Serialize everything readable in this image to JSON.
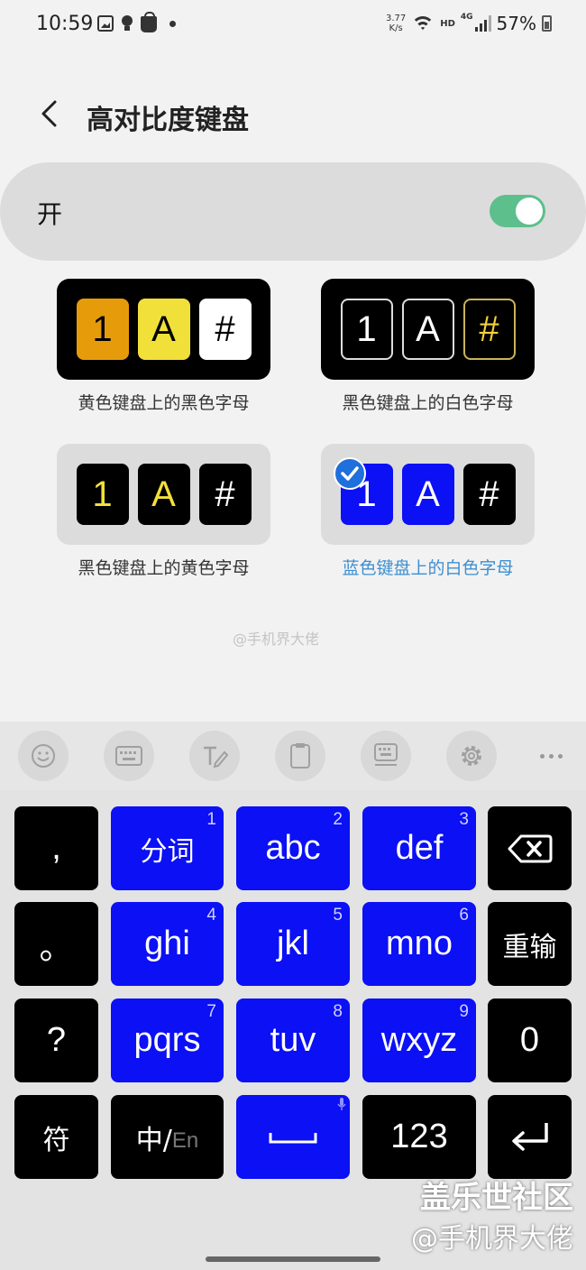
{
  "status_bar": {
    "time": "10:59",
    "net_speed_value": "3.77",
    "net_speed_unit": "K/s",
    "hd": "HD",
    "network": "4G",
    "battery": "57%"
  },
  "header": {
    "title": "高对比度键盘"
  },
  "toggle": {
    "label": "开",
    "state": "on",
    "color": "#5dbf8c"
  },
  "themes": [
    {
      "caption": "黄色键盘上的黑色字母",
      "keys": [
        "1",
        "A",
        "#"
      ],
      "selected": false
    },
    {
      "caption": "黑色键盘上的白色字母",
      "keys": [
        "1",
        "A",
        "#"
      ],
      "selected": false
    },
    {
      "caption": "黑色键盘上的黄色字母",
      "keys": [
        "1",
        "A",
        "#"
      ],
      "selected": false
    },
    {
      "caption": "蓝色键盘上的白色字母",
      "keys": [
        "1",
        "A",
        "#"
      ],
      "selected": true
    }
  ],
  "watermark_mid": "@手机界大佬",
  "toolbar_icons": [
    "emoji-icon",
    "keyboard-icon",
    "handwriting-icon",
    "clipboard-icon",
    "keyboard-mode-icon",
    "gear-icon",
    "more-icon"
  ],
  "keyboard": {
    "row1": {
      "left": ",",
      "k1": "分词",
      "n1": "1",
      "k2": "abc",
      "n2": "2",
      "k3": "def",
      "n3": "3"
    },
    "row2": {
      "left": "。",
      "k1": "ghi",
      "n1": "4",
      "k2": "jkl",
      "n2": "5",
      "k3": "mno",
      "n3": "6",
      "right": "重输"
    },
    "row3": {
      "left": "?",
      "k1": "pqrs",
      "n1": "7",
      "k2": "tuv",
      "n2": "8",
      "k3": "wxyz",
      "n3": "9",
      "right": "0"
    },
    "row4": {
      "left": "符",
      "lang_cn": "中/",
      "lang_en": "En",
      "num": "123"
    },
    "colors": {
      "blue": "#0b10f5",
      "black": "#000000"
    }
  },
  "watermark_br_1": "盖乐世社区",
  "watermark_br_2": "@手机界大佬"
}
